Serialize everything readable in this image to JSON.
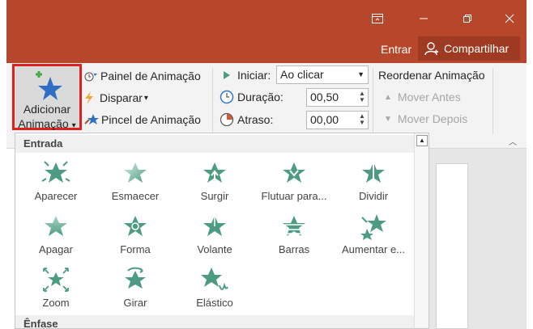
{
  "window": {
    "buttons": [
      "restore-ribbon-icon",
      "minimize-icon",
      "maximize-icon",
      "close-icon"
    ],
    "entrar": "Entrar",
    "share": "Compartilhar"
  },
  "ribbon": {
    "add_animation": {
      "line1": "Adicionar",
      "line2": "Animação",
      "arrow": "▾"
    },
    "col2": {
      "painel": "Painel de Animação",
      "disparar": "Disparar",
      "disparar_arrow": "▾",
      "pincel": "Pincel de Animação"
    },
    "timing": {
      "iniciar_label": "Iniciar:",
      "iniciar_value": "Ao clicar",
      "duracao_label": "Duração:",
      "duracao_value": "00,50",
      "atraso_label": "Atraso:",
      "atraso_value": "00,00"
    },
    "reorder": {
      "title": "Reordenar Animação",
      "move_earlier": "Mover Antes",
      "move_later": "Mover Depois"
    }
  },
  "gallery": {
    "section_entrada": "Entrada",
    "section_enfase": "Ênfase",
    "items": [
      {
        "label": "Aparecer",
        "icon": "appear-icon"
      },
      {
        "label": "Esmaecer",
        "icon": "fade-icon"
      },
      {
        "label": "Surgir",
        "icon": "fly-in-icon"
      },
      {
        "label": "Flutuar para...",
        "icon": "float-in-icon"
      },
      {
        "label": "Dividir",
        "icon": "split-icon"
      },
      {
        "label": "Apagar",
        "icon": "wipe-icon"
      },
      {
        "label": "Forma",
        "icon": "shape-icon"
      },
      {
        "label": "Volante",
        "icon": "wheel-icon"
      },
      {
        "label": "Barras",
        "icon": "random-bars-icon"
      },
      {
        "label": "Aumentar e...",
        "icon": "grow-turn-icon"
      },
      {
        "label": "Zoom",
        "icon": "zoom-icon"
      },
      {
        "label": "Girar",
        "icon": "swivel-icon"
      },
      {
        "label": "Elástico",
        "icon": "bounce-icon"
      }
    ]
  },
  "colors": {
    "titlebar": "#b7472a",
    "accent_green": "#4d9b82",
    "highlight_border": "#e01f1f"
  }
}
